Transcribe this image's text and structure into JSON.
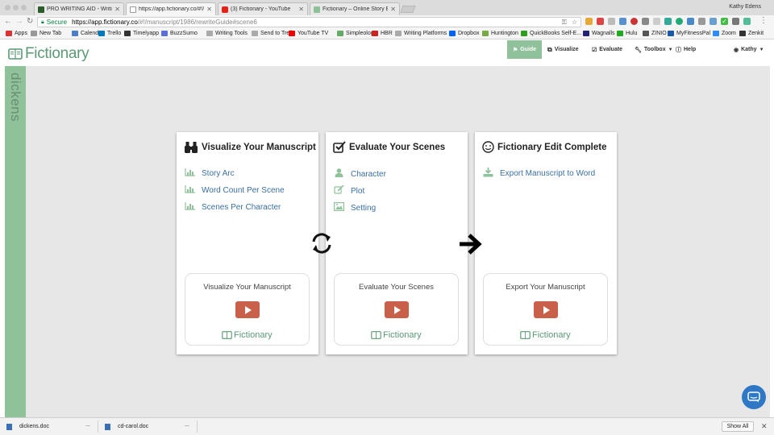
{
  "browser": {
    "tabs": [
      {
        "title": "PRO WRITING AID - Writing Ai",
        "fav_color": "#2b5c2b"
      },
      {
        "title": "https://app.fictionary.co/#!/m",
        "fav_color": "#ffffff"
      },
      {
        "title": "(3) Fictionary - YouTube",
        "fav_color": "#e62117"
      },
      {
        "title": "Fictionary – Online Story Editi",
        "fav_color": "#8fc19a"
      }
    ],
    "profile_name": "Kathy Edens",
    "secure_label": "Secure",
    "url_host": "https://app.fictionary.co",
    "url_path": "/#!/manuscript/1986/rewriteGuide#scene6",
    "bookmarks": [
      "Apps",
      "New Tab",
      "Calendar",
      "Trello",
      "Timelyapp",
      "BuzzSumo",
      "Writing Tools",
      "Send to Trello",
      "YouTube TV",
      "Simpleology",
      "HBR",
      "Writing Platforms",
      "Dropbox",
      "Huntington",
      "QuickBooks Self-E...",
      "Wagnalls",
      "Hulu",
      "ZINIO",
      "MyFitnessPal",
      "Zoom",
      "Zenkit"
    ]
  },
  "app": {
    "logo": "Fictionary",
    "nav": {
      "guide": "Guide",
      "visualize": "Visualize",
      "evaluate": "Evaluate",
      "toolbox": "Toolbox",
      "help": "Help",
      "user": "Kathy"
    },
    "side_tab": "dickens",
    "panels": [
      {
        "title": "Visualize Your Manuscript",
        "links": [
          "Story Arc",
          "Word Count Per Scene",
          "Scenes Per Character"
        ],
        "video_title": "Visualize Your Manuscript",
        "video_logo": "Fictionary"
      },
      {
        "title": "Evaluate Your Scenes",
        "links": [
          "Character",
          "Plot",
          "Setting"
        ],
        "video_title": "Evaluate Your Scenes",
        "video_logo": "Fictionary"
      },
      {
        "title": "Fictionary Edit Complete",
        "links": [
          "Export Manuscript to Word"
        ],
        "video_title": "Export Your Manuscript",
        "video_logo": "Fictionary"
      }
    ],
    "link_color": "#3a6fa3",
    "accent": "#8fc19a"
  },
  "downloads": {
    "items": [
      "dickens.doc",
      "cd-carol.doc"
    ],
    "more": "...",
    "show_all": "Show All"
  }
}
